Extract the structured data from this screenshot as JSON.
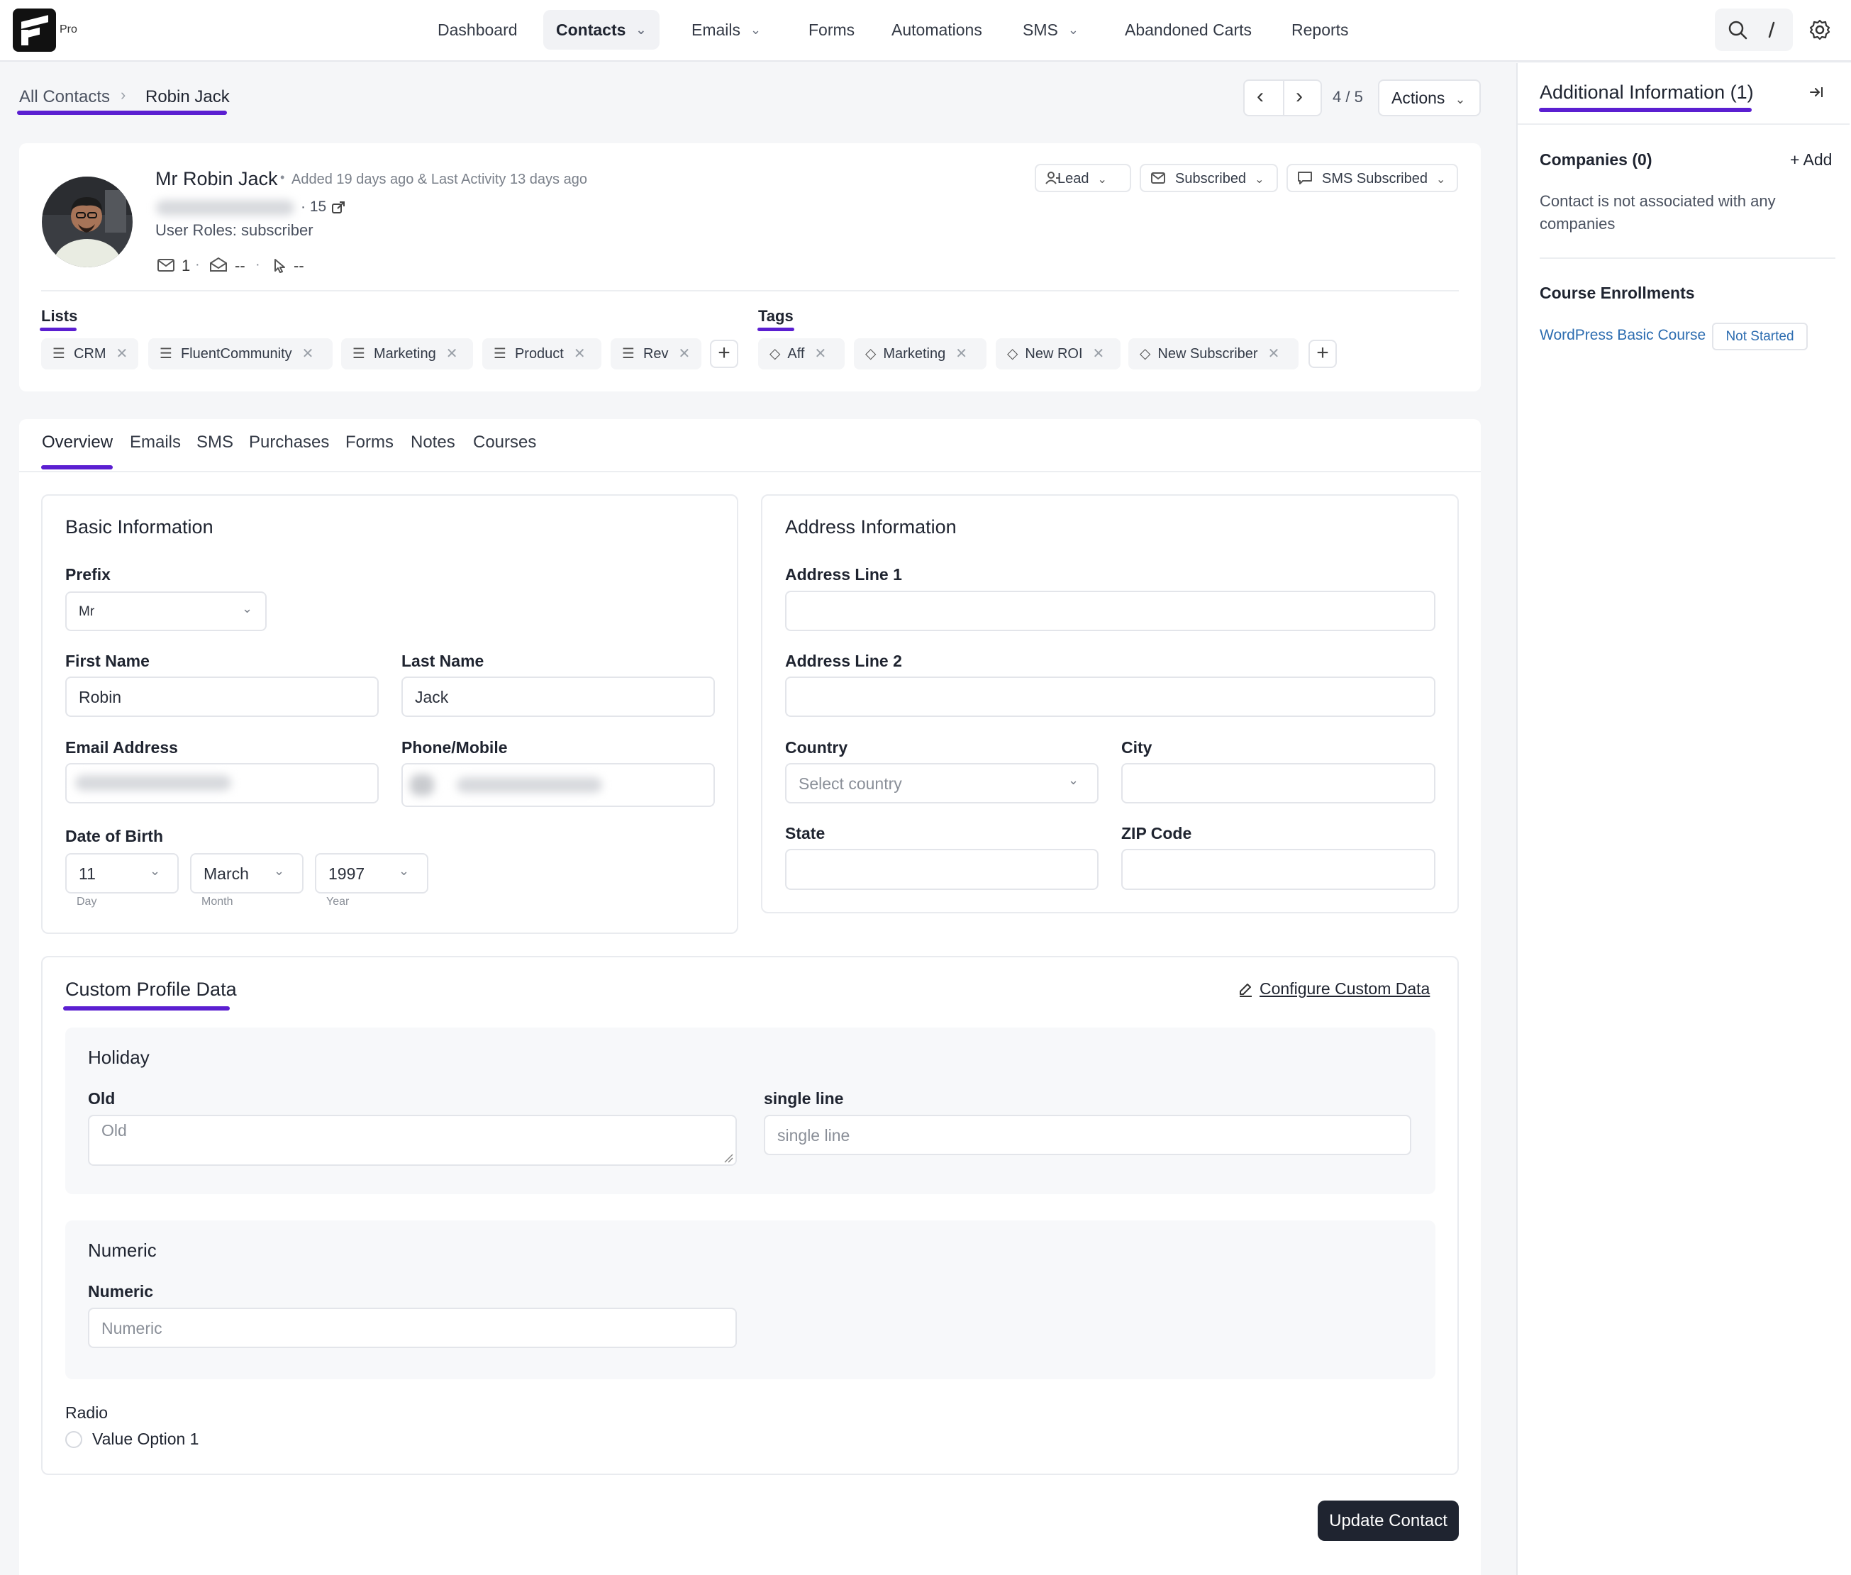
{
  "brand": {
    "label": "Pro"
  },
  "nav": {
    "dashboard": "Dashboard",
    "contacts": "Contacts",
    "emails": "Emails",
    "forms": "Forms",
    "automations": "Automations",
    "sms": "SMS",
    "abandoned_carts": "Abandoned Carts",
    "reports": "Reports"
  },
  "breadcrumb": {
    "parent": "All Contacts",
    "current": "Robin Jack"
  },
  "pager": {
    "position": "4 / 5",
    "actions_label": "Actions"
  },
  "contact": {
    "name": "Mr Robin Jack",
    "meta": "Added 19 days ago & Last Activity 13 days ago",
    "id_suffix": "· 15",
    "roles": "User Roles: subscriber",
    "emails_sent": "1",
    "opens": "--",
    "clicks": "--",
    "status_lead": "Lead",
    "status_subscribed": "Subscribed",
    "status_sms": "SMS Subscribed"
  },
  "lists": {
    "title": "Lists",
    "items": [
      "CRM",
      "FluentCommunity",
      "Marketing",
      "Product",
      "Rev"
    ]
  },
  "tags": {
    "title": "Tags",
    "items": [
      "Aff",
      "Marketing",
      "New ROI",
      "New Subscriber"
    ]
  },
  "tabs": [
    "Overview",
    "Emails",
    "SMS",
    "Purchases",
    "Forms",
    "Notes",
    "Courses"
  ],
  "basic": {
    "title": "Basic Information",
    "prefix_label": "Prefix",
    "prefix_value": "Mr",
    "first_name_label": "First Name",
    "first_name_value": "Robin",
    "last_name_label": "Last Name",
    "last_name_value": "Jack",
    "email_label": "Email Address",
    "phone_label": "Phone/Mobile",
    "dob_label": "Date of Birth",
    "dob_day": "11",
    "dob_month": "March",
    "dob_year": "1997",
    "day_hint": "Day",
    "month_hint": "Month",
    "year_hint": "Year"
  },
  "address": {
    "title": "Address Information",
    "line1_label": "Address Line 1",
    "line2_label": "Address Line 2",
    "country_label": "Country",
    "country_placeholder": "Select country",
    "city_label": "City",
    "state_label": "State",
    "zip_label": "ZIP Code"
  },
  "custom": {
    "title": "Custom Profile Data",
    "configure_label": "Configure Custom Data",
    "holiday_title": "Holiday",
    "old_label": "Old",
    "old_placeholder": "Old",
    "single_label": "single line",
    "single_placeholder": "single line",
    "numeric_title": "Numeric",
    "numeric_label": "Numeric",
    "numeric_placeholder": "Numeric",
    "radio_label": "Radio",
    "radio_option": "Value Option 1"
  },
  "update_button": "Update Contact",
  "side": {
    "title": "Additional Information (1)",
    "companies_title": "Companies (0)",
    "add_label": "+ Add",
    "companies_empty_1": "Contact is not associated with any",
    "companies_empty_2": "companies",
    "courses_title": "Course Enrollments",
    "course_name": "WordPress Basic Course",
    "course_status": "Not Started"
  },
  "colors": {
    "accent": "#5b1fd1",
    "link": "#2c6cb0",
    "primary_button": "#1f2430"
  }
}
